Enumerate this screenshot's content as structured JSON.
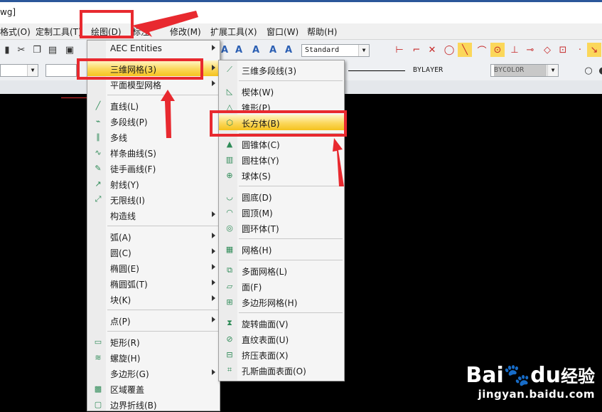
{
  "window": {
    "title_fragment": "wg]"
  },
  "menubar": {
    "items": [
      "格式(O)",
      "定制工具(T)",
      "绘图(D)",
      "标注",
      "修改(M)",
      "扩展工具(X)",
      "窗口(W)",
      "帮助(H)"
    ]
  },
  "toolbar": {
    "text_style": "Standard",
    "linetype": "BYLAYER",
    "color": "BYCOLOR"
  },
  "draw_menu": {
    "items": [
      {
        "label": "AEC Entities",
        "icon": "",
        "submenu": true
      },
      {
        "label": "三维网格(3)",
        "icon": "",
        "submenu": true,
        "highlighted": true
      },
      {
        "label": "平面模型网格",
        "icon": "",
        "submenu": true
      },
      {
        "label": "直线(L)",
        "icon": "line-icon"
      },
      {
        "label": "多段线(P)",
        "icon": "polyline-icon"
      },
      {
        "label": "多线",
        "icon": "multiline-icon"
      },
      {
        "label": "样条曲线(S)",
        "icon": "spline-icon"
      },
      {
        "label": "徒手画线(F)",
        "icon": "freehand-icon"
      },
      {
        "label": "射线(Y)",
        "icon": "ray-icon"
      },
      {
        "label": "无限线(I)",
        "icon": "xline-icon"
      },
      {
        "label": "构造线",
        "icon": "",
        "submenu": true
      },
      {
        "label": "弧(A)",
        "icon": "",
        "submenu": true
      },
      {
        "label": "圆(C)",
        "icon": "",
        "submenu": true
      },
      {
        "label": "椭圆(E)",
        "icon": "",
        "submenu": true
      },
      {
        "label": "椭圆弧(T)",
        "icon": "",
        "submenu": true
      },
      {
        "label": "块(K)",
        "icon": "",
        "submenu": true
      },
      {
        "label": "点(P)",
        "icon": "",
        "submenu": true
      },
      {
        "label": "矩形(R)",
        "icon": "rectangle-icon"
      },
      {
        "label": "螺旋(H)",
        "icon": "helix-icon"
      },
      {
        "label": "多边形(G)",
        "icon": "",
        "submenu": true
      },
      {
        "label": "区域覆盖",
        "icon": "wipeout-icon"
      },
      {
        "label": "边界折线(B)",
        "icon": "boundary-icon"
      }
    ]
  },
  "mesh_submenu": {
    "items": [
      {
        "label": "三维多段线(3)",
        "icon": "3d-polyline-icon"
      },
      {
        "label": "楔体(W)",
        "icon": "wedge-icon"
      },
      {
        "label": "锥形(P)",
        "icon": "pyramid-icon"
      },
      {
        "label": "长方体(B)",
        "icon": "box-icon",
        "highlighted": true
      },
      {
        "label": "圆锥体(C)",
        "icon": "cone-icon"
      },
      {
        "label": "圆柱体(Y)",
        "icon": "cylinder-icon"
      },
      {
        "label": "球体(S)",
        "icon": "sphere-icon"
      },
      {
        "label": "圆底(D)",
        "icon": "dish-icon"
      },
      {
        "label": "圆顶(M)",
        "icon": "dome-icon"
      },
      {
        "label": "圆环体(T)",
        "icon": "torus-icon"
      },
      {
        "label": "网格(H)",
        "icon": "mesh-icon"
      },
      {
        "label": "多面网格(L)",
        "icon": "polyface-mesh-icon"
      },
      {
        "label": "面(F)",
        "icon": "3d-face-icon"
      },
      {
        "label": "多边形网格(H)",
        "icon": "polygon-mesh-icon"
      },
      {
        "label": "旋转曲面(V)",
        "icon": "revolved-surface-icon"
      },
      {
        "label": "直纹表面(U)",
        "icon": "ruled-surface-icon"
      },
      {
        "label": "挤压表面(X)",
        "icon": "tabulated-surface-icon"
      },
      {
        "label": "孔斯曲面表面(O)",
        "icon": "edge-surface-icon"
      }
    ]
  },
  "watermark": {
    "brand": "Bai",
    "brand2": "du",
    "site_cn": "经验",
    "url": "jingyan.baidu.com"
  },
  "colors": {
    "highlight": "#fbd75a",
    "annotation_red": "#e8292f",
    "icon_green": "#2e8b57"
  }
}
